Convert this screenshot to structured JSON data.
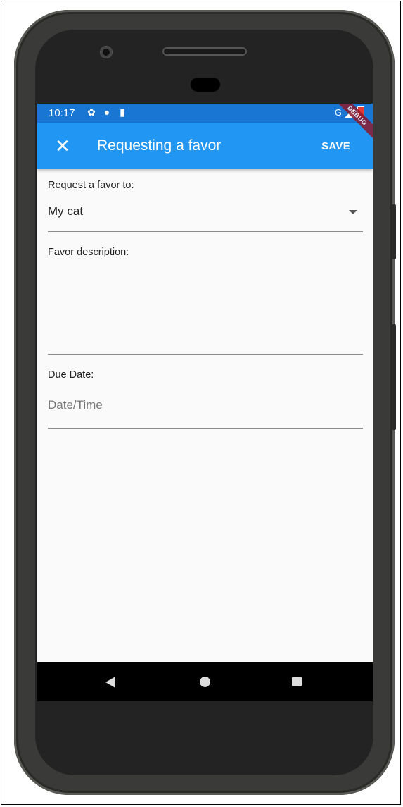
{
  "status_bar": {
    "time": "10:17",
    "icons": [
      "settings-icon",
      "alert-icon",
      "sd-card-icon"
    ],
    "network": "G"
  },
  "app_bar": {
    "title": "Requesting a favor",
    "close_icon": "close-icon",
    "save_label": "SAVE",
    "debug_banner": "DEBUG",
    "color": "#2196f3",
    "status_color": "#1976d2"
  },
  "form": {
    "request_to": {
      "label": "Request a favor to:",
      "value": "My cat"
    },
    "description": {
      "label": "Favor description:",
      "value": ""
    },
    "due_date": {
      "label": "Due Date:",
      "placeholder": "Date/Time"
    }
  },
  "nav_bar": {
    "buttons": [
      "back-icon",
      "home-icon",
      "recents-icon"
    ]
  }
}
